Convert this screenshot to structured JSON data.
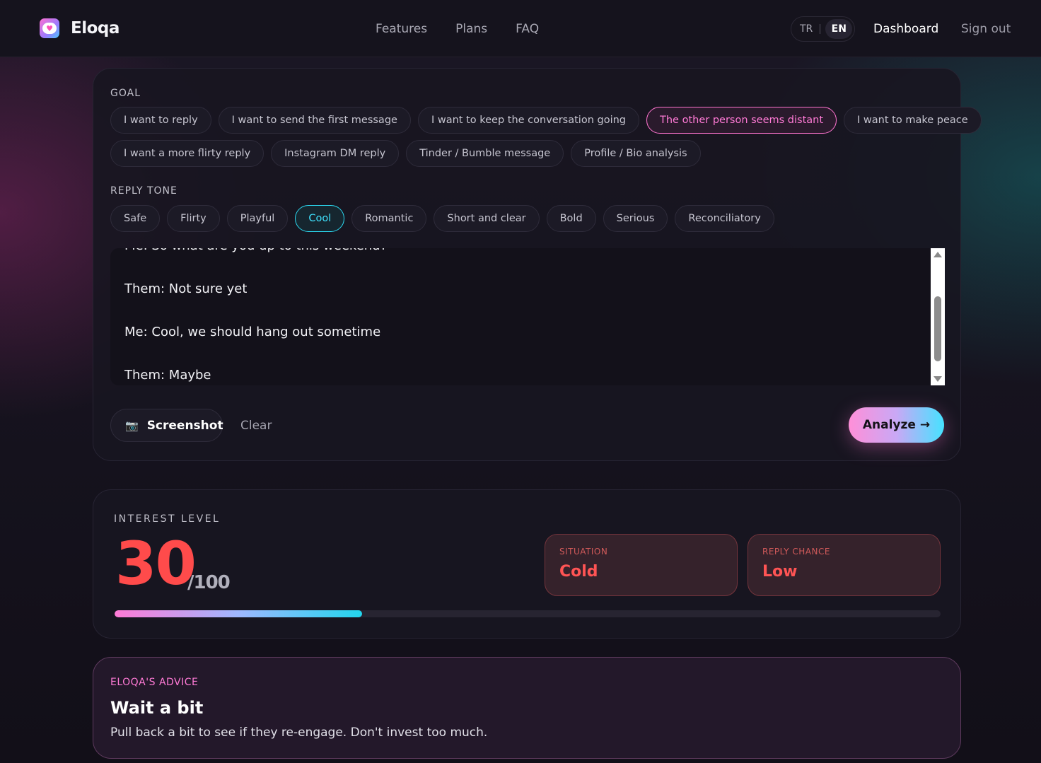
{
  "nav": {
    "brand": "Eloqa",
    "links": [
      "Features",
      "Plans",
      "FAQ"
    ],
    "lang_tr": "TR",
    "lang_en": "EN",
    "dashboard": "Dashboard",
    "signout": "Sign out"
  },
  "goal": {
    "label": "GOAL",
    "row1": [
      "I want to reply",
      "I want to send the first message",
      "I want to keep the conversation going",
      "The other person seems distant",
      "I want to make peace"
    ],
    "row2": [
      "I want a more flirty reply",
      "Instagram DM reply",
      "Tinder / Bumble message",
      "Profile / Bio analysis"
    ],
    "selected": "The other person seems distant"
  },
  "tone": {
    "label": "REPLY TONE",
    "options": [
      "Safe",
      "Flirty",
      "Playful",
      "Cool",
      "Romantic",
      "Short and clear",
      "Bold",
      "Serious",
      "Reconciliatory"
    ],
    "selected": "Cool"
  },
  "conversation": {
    "lines": [
      "Me: So what are you up to this weekend?",
      "Them: Not sure yet",
      "Me: Cool, we should hang out sometime",
      "Them: Maybe"
    ]
  },
  "actions": {
    "screenshot": "Screenshot",
    "clear": "Clear",
    "analyze": "Analyze →"
  },
  "interest": {
    "label": "INTEREST LEVEL",
    "score": "30",
    "max": "/100",
    "level_fraction": 0.3,
    "situation_label": "SITUATION",
    "situation_value": "Cold",
    "chance_label": "REPLY CHANCE",
    "chance_value": "Low"
  },
  "advice": {
    "label": "ELOQA'S ADVICE",
    "title": "Wait a bit",
    "text": "Pull back a bit to see if they re-engage. Don't invest too much."
  },
  "icons": {
    "logo": "heart-chat-logo-icon",
    "screenshot": "camera-icon"
  }
}
